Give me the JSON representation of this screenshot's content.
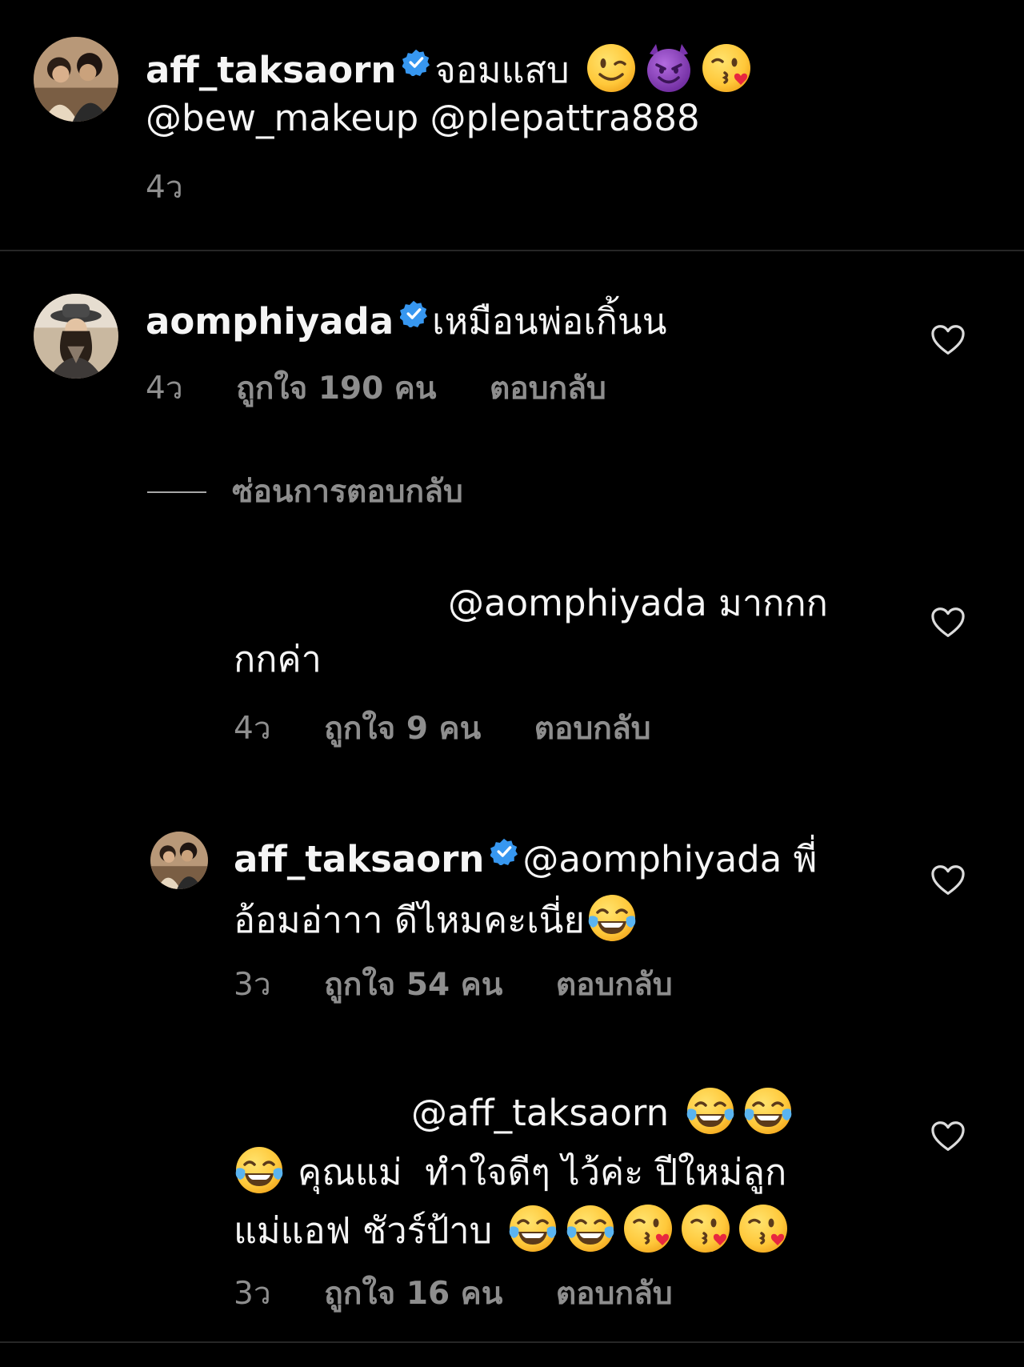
{
  "caption": {
    "username": "aff_taksaorn",
    "text": "จอมแสบ",
    "mentions": "@bew_makeup @plepattra888",
    "time": "4ว",
    "emojis": [
      "winking-face",
      "smiling-face-with-horns",
      "face-blowing-kiss"
    ]
  },
  "comments": [
    {
      "username": "aomphiyada",
      "text": "เหมือนพ่อเกิ้นน",
      "time": "4ว",
      "likes": "ถูกใจ 190 คน",
      "reply_label": "ตอบกลับ"
    }
  ],
  "hide_replies_label": "ซ่อนการตอบกลับ",
  "replies": [
    {
      "line1": "@aomphiyada มากกก",
      "line2": "กกค่า",
      "time": "4ว",
      "likes": "ถูกใจ 9 คน",
      "reply_label": "ตอบกลับ"
    },
    {
      "username": "aff_taksaorn",
      "line1_rest": "@aomphiyada พี่",
      "line2": "อ้อมอ่าาา ดีไหมคะเนี่ย",
      "time": "3ว",
      "likes": "ถูกใจ 54 คน",
      "reply_label": "ตอบกลับ",
      "emojis": [
        "face-with-tears-of-joy"
      ]
    },
    {
      "line1": "@aff_taksaorn",
      "line2": "คุณแม่  ทำใจดีๆ ไว้ค่ะ ปีใหม่ลูก",
      "line3": "แม่แอฟ ชัวร์ป้าบ",
      "time": "3ว",
      "likes": "ถูกใจ 16 คน",
      "reply_label": "ตอบกลับ",
      "emojis": [
        "face-with-tears-of-joy",
        "face-with-tears-of-joy",
        "face-with-tears-of-joy",
        "face-with-tears-of-joy",
        "face-with-tears-of-joy",
        "face-blowing-kiss",
        "face-blowing-kiss",
        "face-blowing-kiss"
      ]
    }
  ],
  "colors": {
    "background": "#000000",
    "text": "#f5f5f5",
    "muted": "#8e8e8e",
    "verified": "#3797f0",
    "divider": "#262626"
  }
}
